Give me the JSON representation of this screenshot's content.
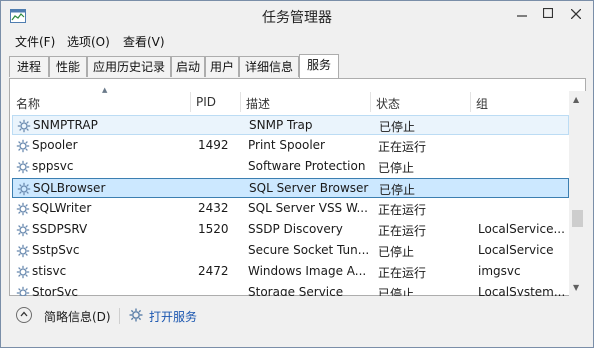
{
  "window": {
    "title": "任务管理器"
  },
  "menu": [
    "文件(F)",
    "选项(O)",
    "查看(V)"
  ],
  "tabs": [
    {
      "label": "进程",
      "active": false
    },
    {
      "label": "性能",
      "active": false
    },
    {
      "label": "应用历史记录",
      "active": false
    },
    {
      "label": "启动",
      "active": false
    },
    {
      "label": "用户",
      "active": false
    },
    {
      "label": "详细信息",
      "active": false
    },
    {
      "label": "服务",
      "active": true
    }
  ],
  "columns": {
    "name": "名称",
    "pid": "PID",
    "desc": "描述",
    "status": "状态",
    "group": "组"
  },
  "rows": [
    {
      "name": "SNMPTRAP",
      "pid": "",
      "desc": "SNMP Trap",
      "status": "已停止",
      "group": ""
    },
    {
      "name": "Spooler",
      "pid": "1492",
      "desc": "Print Spooler",
      "status": "正在运行",
      "group": ""
    },
    {
      "name": "sppsvc",
      "pid": "",
      "desc": "Software Protection",
      "status": "已停止",
      "group": ""
    },
    {
      "name": "SQLBrowser",
      "pid": "",
      "desc": "SQL Server Browser",
      "status": "已停止",
      "group": ""
    },
    {
      "name": "SQLWriter",
      "pid": "2432",
      "desc": "SQL Server VSS W...",
      "status": "正在运行",
      "group": ""
    },
    {
      "name": "SSDPSRV",
      "pid": "1520",
      "desc": "SSDP Discovery",
      "status": "正在运行",
      "group": "LocalService..."
    },
    {
      "name": "SstpSvc",
      "pid": "",
      "desc": "Secure Socket Tun...",
      "status": "已停止",
      "group": "LocalService"
    },
    {
      "name": "stisvc",
      "pid": "2472",
      "desc": "Windows Image A...",
      "status": "正在运行",
      "group": "imgsvc"
    },
    {
      "name": "StorSvc",
      "pid": "",
      "desc": "Storage Service",
      "status": "已停止",
      "group": "LocalSystem..."
    }
  ],
  "hovered_row": "SNMPTRAP",
  "selected_row": "SQLBrowser",
  "footer": {
    "fewer_details": "简略信息(D)",
    "open_services": "打开服务"
  },
  "colors": {
    "selection": "#cce8ff",
    "selection_border": "#3c7fb1",
    "hover": "#eaf4fc",
    "link": "#1a56b0"
  },
  "icons": {
    "app": "task-manager-icon",
    "service": "gear-icon",
    "collapse": "chevron-up-icon"
  }
}
